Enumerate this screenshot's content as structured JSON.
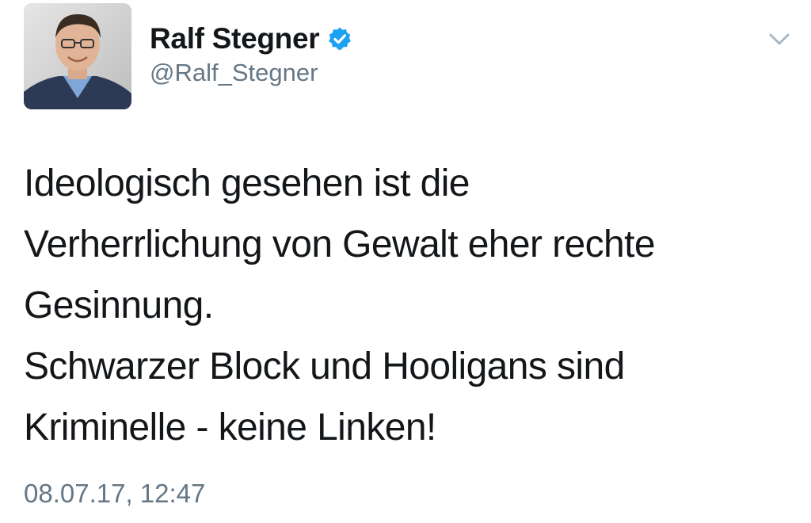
{
  "colors": {
    "text": "#14171a",
    "secondary": "#657786",
    "verified": "#1da1f2",
    "background": "#ffffff"
  },
  "author": {
    "display_name": "Ralf Stegner",
    "handle": "@Ralf_Stegner",
    "verified": true,
    "avatar_icon": "profile-photo"
  },
  "tweet": {
    "lines": [
      "Ideologisch gesehen ist die",
      "Verherrlichung von Gewalt eher rechte",
      "Gesinnung.",
      "Schwarzer Block und Hooligans sind",
      "Kriminelle - keine Linken!"
    ],
    "timestamp": "08.07.17, 12:47"
  },
  "menu": {
    "icon": "chevron-down-icon"
  }
}
